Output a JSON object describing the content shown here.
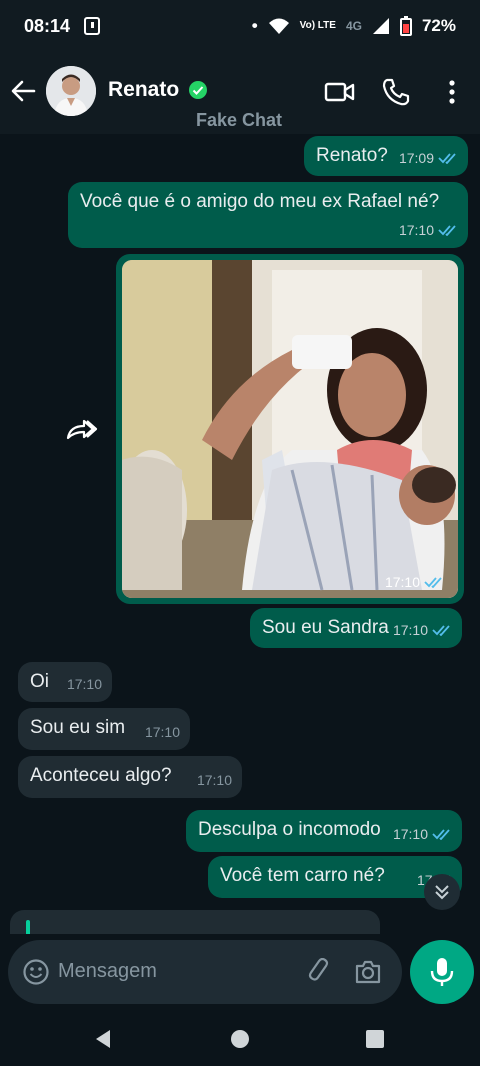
{
  "status": {
    "time": "08:14",
    "network": "Vo) LTE",
    "signal": "4G",
    "battery": "72%"
  },
  "header": {
    "contact_name": "Renato",
    "subtitle": "Fake Chat"
  },
  "messages": [
    {
      "text": "Renato?",
      "time": "17:09"
    },
    {
      "text": "Você que é o amigo do meu ex Rafael né?",
      "time": "17:10"
    },
    {
      "time": "17:10"
    },
    {
      "text": "Sou eu Sandra",
      "time": "17:10"
    },
    {
      "text": "Oi",
      "time": "17:10"
    },
    {
      "text": "Sou eu sim",
      "time": "17:10"
    },
    {
      "text": "Aconteceu algo?",
      "time": "17:10"
    },
    {
      "text": "Desculpa o incomodo",
      "time": "17:10"
    },
    {
      "text": "Você tem carro né?",
      "time": "17:10"
    }
  ],
  "composer": {
    "placeholder": "Mensagem"
  },
  "colors": {
    "outgoing": "#005c4b",
    "incoming": "#202c33",
    "accent": "#00a884",
    "read_ticks": "#53bdeb"
  },
  "icons": [
    "back-arrow-icon",
    "verified-badge-icon",
    "video-call-icon",
    "phone-icon",
    "more-icon",
    "forward-icon",
    "scroll-down-icon",
    "emoji-icon",
    "attach-icon",
    "camera-icon",
    "mic-icon"
  ]
}
